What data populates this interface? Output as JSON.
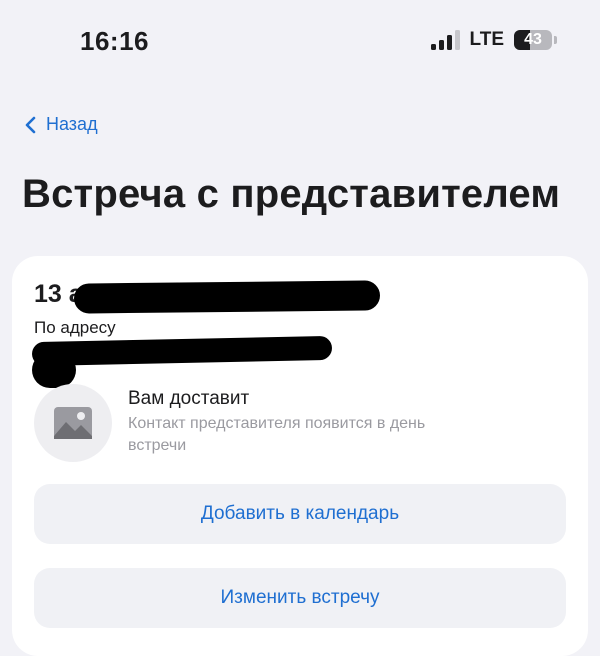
{
  "status_bar": {
    "time": "16:16",
    "network": "LTE",
    "battery": "43",
    "battery_level_percent": 43
  },
  "nav": {
    "back_label": "Назад"
  },
  "page": {
    "title": "Встреча с представителем"
  },
  "meeting": {
    "date_prefix": "13 а",
    "address_label": "По адресу",
    "courier": {
      "title": "Вам доставит",
      "subtitle": "Контакт представителя появится в день встречи"
    },
    "actions": {
      "add_to_calendar": "Добавить в календарь",
      "change_meeting": "Изменить встречу"
    }
  },
  "colors": {
    "accent": "#1f6fd1",
    "background": "#f2f2f7",
    "card": "#ffffff",
    "button_bg": "#f0f1f5",
    "secondary_text": "#9a9aa0"
  }
}
